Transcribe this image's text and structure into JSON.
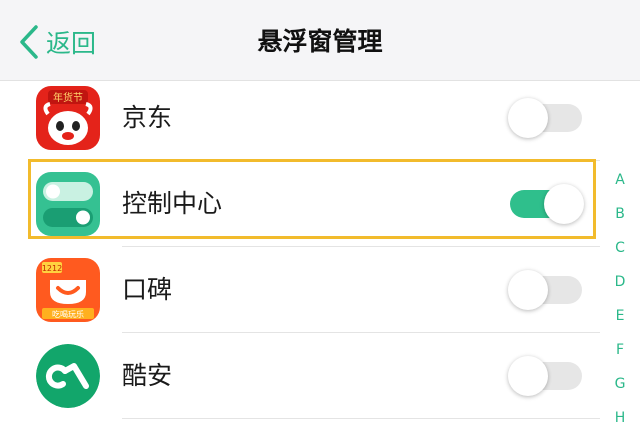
{
  "header": {
    "back_label": "返回",
    "title": "悬浮窗管理"
  },
  "apps": [
    {
      "name": "京东",
      "icon": "jd-app-icon",
      "icon_badge": "年货节",
      "enabled": false
    },
    {
      "name": "控制中心",
      "icon": "control-center-app-icon",
      "enabled": true,
      "highlighted": true
    },
    {
      "name": "口碑",
      "icon": "koubei-app-icon",
      "icon_badge": "1212",
      "icon_caption": "吃喝玩乐",
      "enabled": false
    },
    {
      "name": "酷安",
      "icon": "coolapk-app-icon",
      "enabled": false
    }
  ],
  "index_letters": [
    "A",
    "B",
    "C",
    "D",
    "E",
    "F",
    "G",
    "H"
  ],
  "colors": {
    "accent": "#2bb88a",
    "toggle_on": "#2fbf8c",
    "toggle_off": "#e6e6e6",
    "highlight_border": "#f2bb2c",
    "header_bg": "#f5f5f7"
  }
}
